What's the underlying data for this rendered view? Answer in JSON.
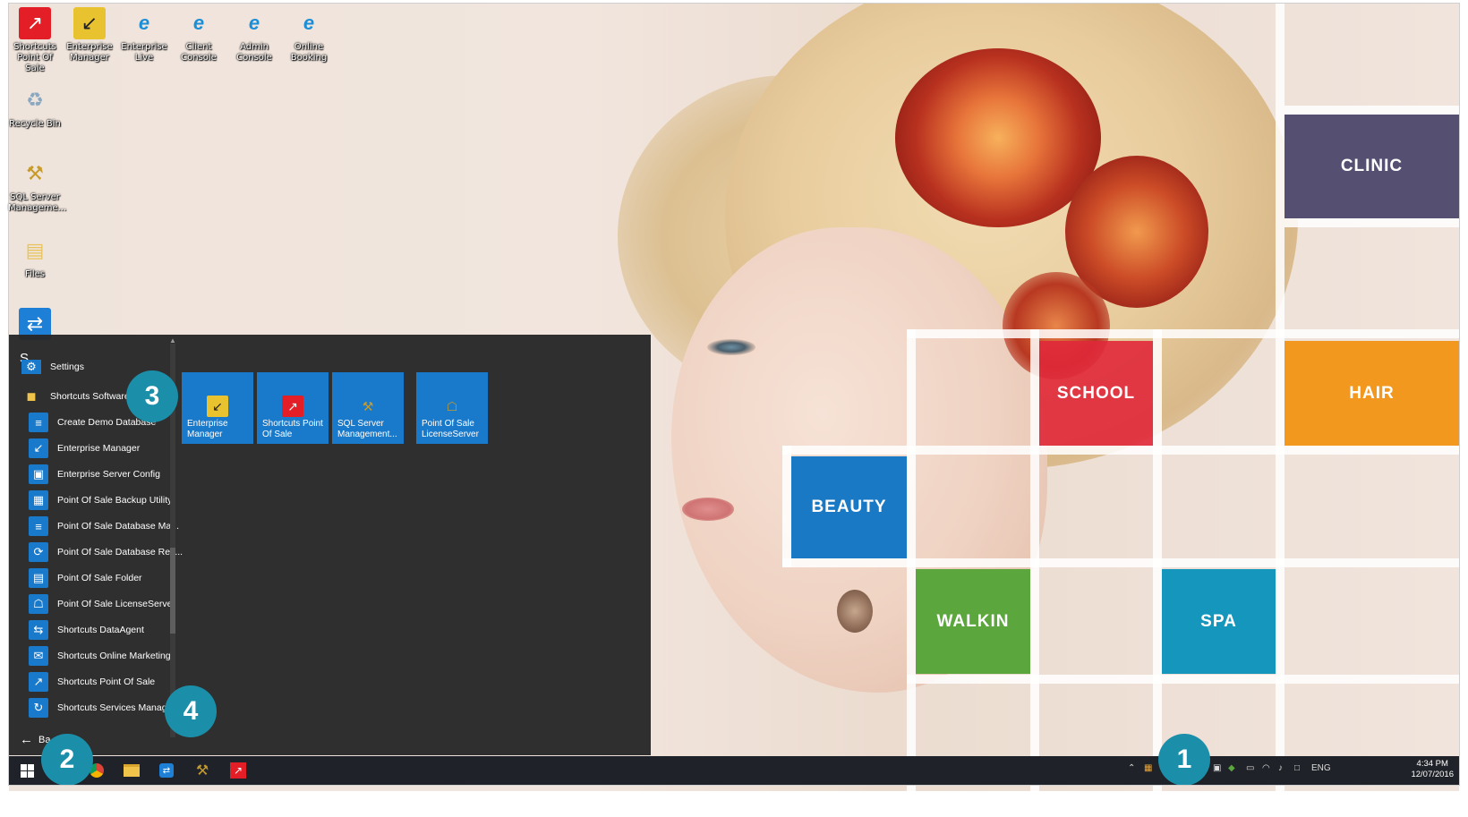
{
  "desktop_icons": [
    {
      "label": "Shortcuts Point Of Sale",
      "icon": "shortcuts-pos-icon"
    },
    {
      "label": "Enterprise Manager",
      "icon": "enterprise-manager-icon"
    },
    {
      "label": "Enterprise Live",
      "icon": "ie-icon"
    },
    {
      "label": "Client Console",
      "icon": "ie-icon"
    },
    {
      "label": "Admin Console",
      "icon": "ie-icon"
    },
    {
      "label": "Online Booking",
      "icon": "ie-icon"
    },
    {
      "label": "Recycle Bin",
      "icon": "recycle-bin-icon"
    },
    {
      "label": "SQL Server Manageme...",
      "icon": "sql-server-icon"
    },
    {
      "label": "Files",
      "icon": "folder-icon"
    }
  ],
  "wallpaper_tiles": [
    {
      "label": "CLINIC",
      "color": "#554f72"
    },
    {
      "label": "SCHOOL",
      "color": "#e0283a"
    },
    {
      "label": "HAIR",
      "color": "#f3981e"
    },
    {
      "label": "BEAUTY",
      "color": "#1a79c4"
    },
    {
      "label": "WALKIN",
      "color": "#5ba63d"
    },
    {
      "label": "SPA",
      "color": "#1596bd"
    }
  ],
  "start_menu": {
    "letter": "S",
    "items": [
      {
        "label": "Settings",
        "icon": "gear-icon"
      },
      {
        "label": "Shortcuts Software",
        "icon": "folder-icon"
      },
      {
        "label": "Create Demo Database",
        "icon": "database-icon"
      },
      {
        "label": "Enterprise Manager",
        "icon": "enterprise-manager-icon"
      },
      {
        "label": "Enterprise Server Config",
        "icon": "monitor-icon"
      },
      {
        "label": "Point Of Sale Backup Utility",
        "icon": "backup-icon"
      },
      {
        "label": "Point Of Sale Database Ma...",
        "icon": "database-icon"
      },
      {
        "label": "Point Of Sale Database Res...",
        "icon": "restore-icon"
      },
      {
        "label": "Point Of Sale Folder",
        "icon": "folder-icon"
      },
      {
        "label": "Point Of Sale LicenseServer",
        "icon": "license-icon"
      },
      {
        "label": "Shortcuts DataAgent",
        "icon": "data-agent-icon"
      },
      {
        "label": "Shortcuts Online Marketing",
        "icon": "mail-icon"
      },
      {
        "label": "Shortcuts Point Of Sale",
        "icon": "shortcuts-pos-icon"
      },
      {
        "label": "Shortcuts Services Manager",
        "icon": "services-icon"
      }
    ],
    "back_label": "Ba",
    "pinned_tiles": [
      {
        "label": "Enterprise Manager",
        "icon": "enterprise-manager-icon"
      },
      {
        "label": "Shortcuts Point Of Sale",
        "icon": "shortcuts-pos-icon"
      },
      {
        "label": "SQL Server Management...",
        "icon": "sql-server-icon"
      },
      {
        "label": "Point Of Sale LicenseServer",
        "icon": "license-icon"
      }
    ]
  },
  "taskbar": {
    "apps": [
      "chrome-icon",
      "file-explorer-icon",
      "teamviewer-icon",
      "sql-server-icon",
      "shortcuts-pos-icon"
    ],
    "language": "ENG",
    "time": "4:34 PM",
    "date": "12/07/2016"
  },
  "callouts": [
    "1",
    "2",
    "3",
    "4"
  ]
}
